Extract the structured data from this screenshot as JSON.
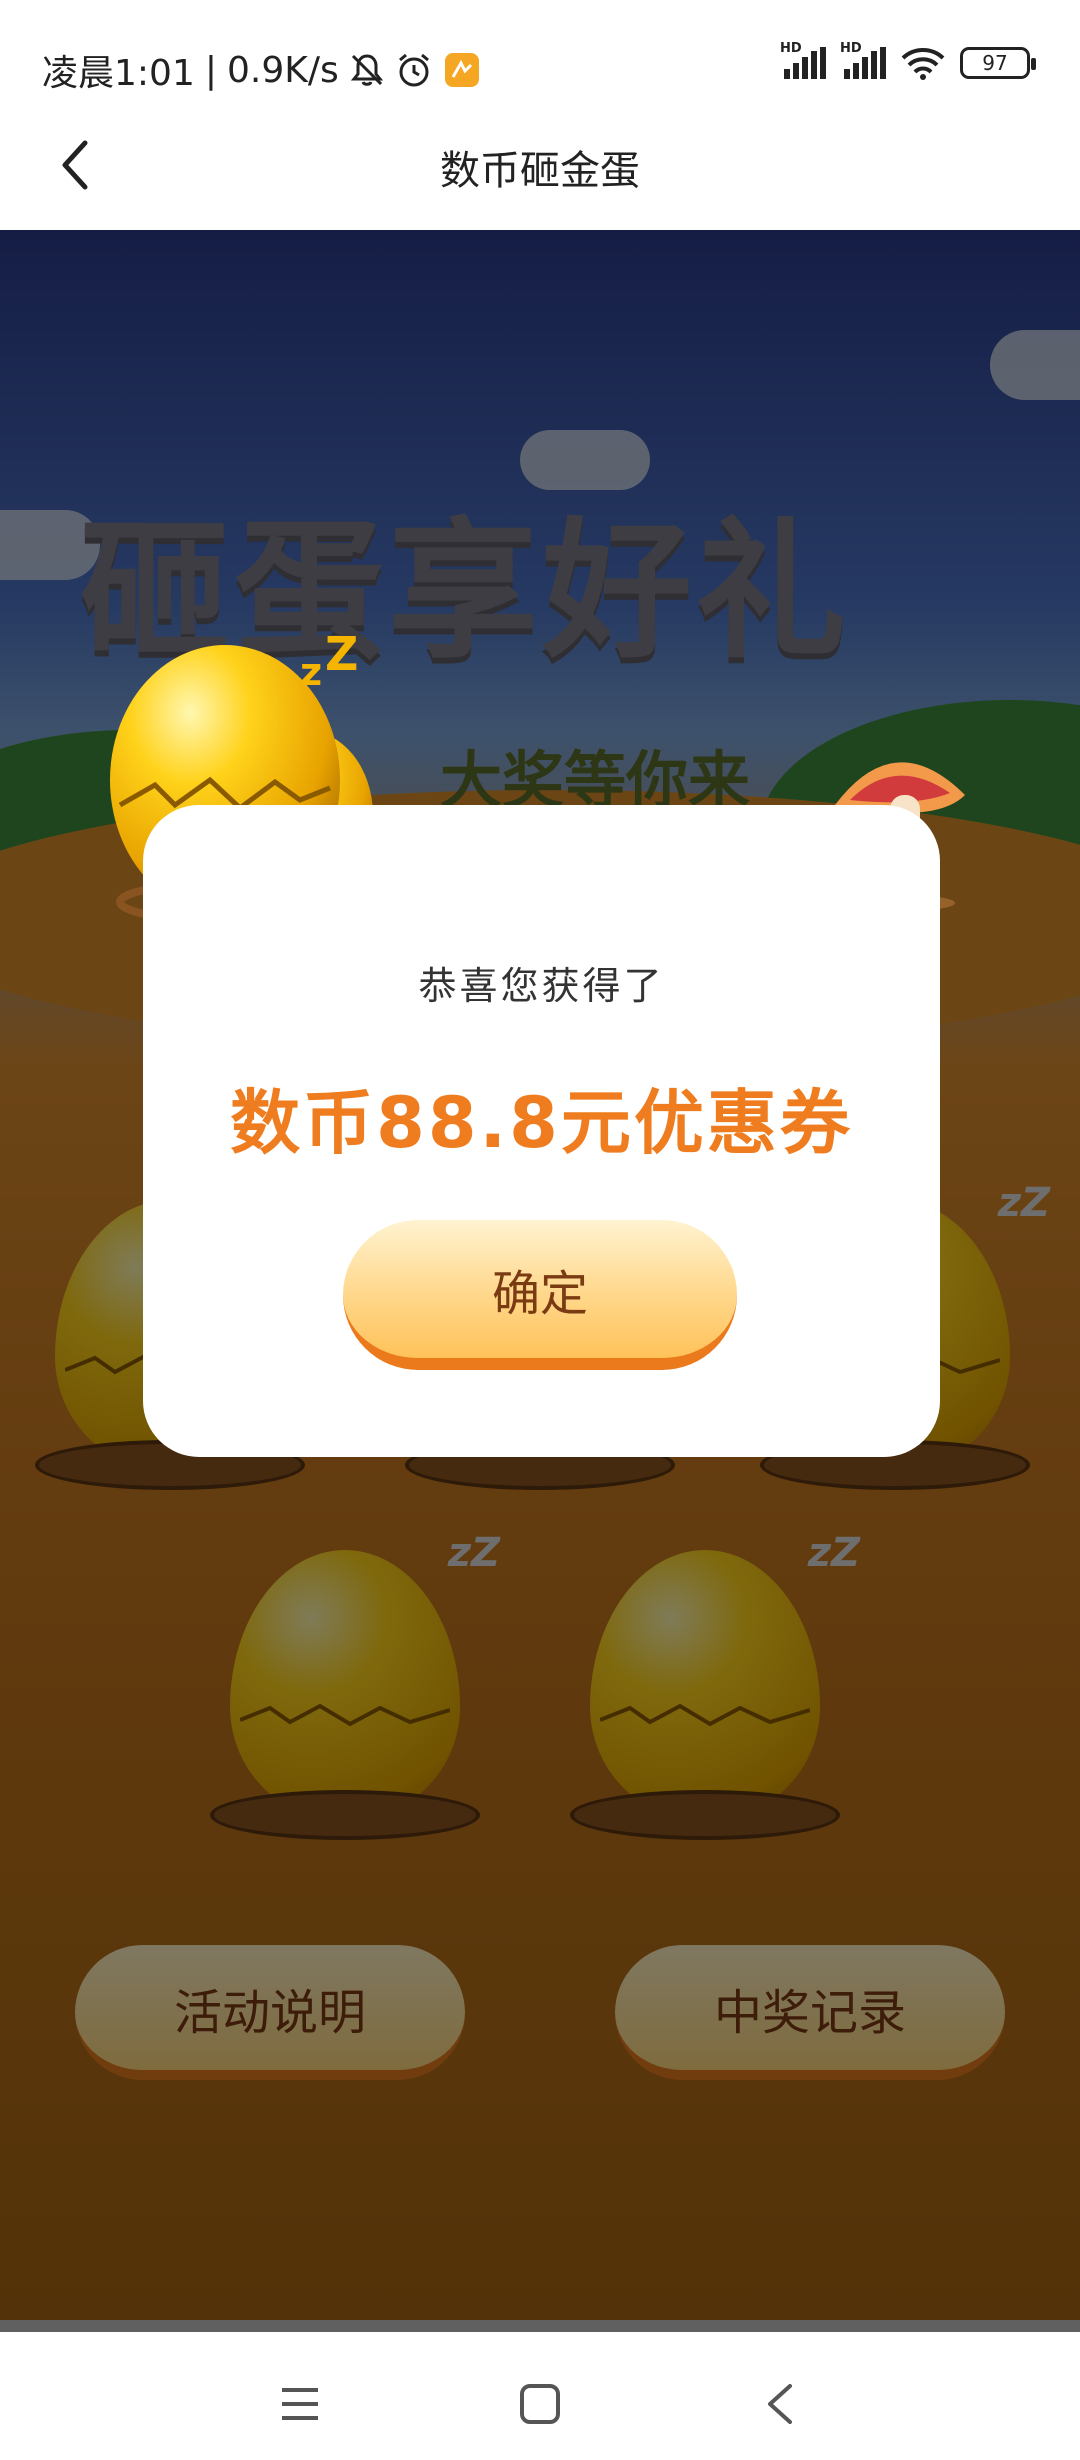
{
  "status_bar": {
    "time": "凌晨1:01",
    "separator": "|",
    "net_speed": "0.9K/s",
    "battery": "97",
    "hd_label": "HD",
    "icons": [
      "bell-off-icon",
      "alarm-icon",
      "app-notification-icon",
      "signal-icon",
      "signal-icon",
      "wifi-icon",
      "battery-icon"
    ]
  },
  "title_bar": {
    "title": "数币砸金蛋",
    "back_icon": "chevron-left-icon"
  },
  "game": {
    "hero_title": "砸蛋享好礼",
    "hero_subtitle": "大奖等你来",
    "zz": "zZ",
    "buttons": {
      "rules": "活动说明",
      "records": "中奖记录"
    }
  },
  "modal": {
    "line1": "恭喜您获得了",
    "prize": "数币88.8元优惠券",
    "confirm": "确定"
  },
  "nav_bar": {
    "icons": [
      "menu-icon",
      "home-square-icon",
      "back-triangle-icon"
    ]
  },
  "colors": {
    "accent_orange": "#ef7d20",
    "button_brown_text": "#7a3a12",
    "overlay": "rgba(0,0,0,0.5)"
  }
}
